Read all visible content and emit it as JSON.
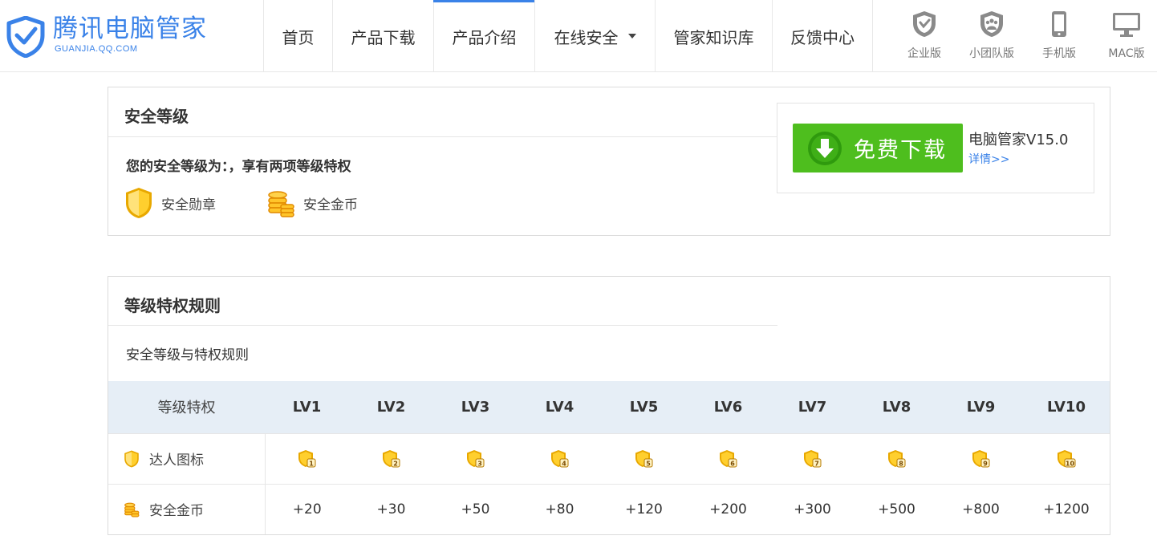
{
  "header": {
    "logo": {
      "title": "腾讯电脑管家",
      "subtitle": "GUANJIA.QQ.COM",
      "icon": "shield-check-icon"
    },
    "nav": [
      {
        "label": "首页",
        "active": false
      },
      {
        "label": "产品下载",
        "active": false
      },
      {
        "label": "产品介绍",
        "active": true
      },
      {
        "label": "在线安全",
        "active": false,
        "dropdown": true
      },
      {
        "label": "管家知识库",
        "active": false
      },
      {
        "label": "反馈中心",
        "active": false
      }
    ],
    "editions": [
      {
        "label": "企业版",
        "icon": "enterprise-shield-icon"
      },
      {
        "label": "小团队版",
        "icon": "team-shield-icon"
      },
      {
        "label": "手机版",
        "icon": "phone-icon"
      },
      {
        "label": "MAC版",
        "icon": "monitor-icon"
      }
    ]
  },
  "security_level": {
    "title": "安全等级",
    "level_text": "您的安全等级为：，享有两项等级特权",
    "perks": [
      {
        "label": "安全勋章",
        "icon": "medal-icon"
      },
      {
        "label": "安全金币",
        "icon": "coins-icon"
      }
    ]
  },
  "download": {
    "button_label": "免费下载",
    "version": "电脑管家V15.0",
    "detail_link": "详情>>"
  },
  "rules": {
    "title": "等级特权规则",
    "subtitle": "安全等级与特权规则",
    "header_first": "等级特权",
    "levels": [
      "LV1",
      "LV2",
      "LV3",
      "LV4",
      "LV5",
      "LV6",
      "LV7",
      "LV8",
      "LV9",
      "LV10"
    ],
    "badge_row_label": "达人图标",
    "badge_numbers": [
      "1",
      "2",
      "3",
      "4",
      "5",
      "6",
      "7",
      "8",
      "9",
      "10"
    ],
    "coin_row_label": "安全金币",
    "coins": [
      "+20",
      "+30",
      "+50",
      "+80",
      "+120",
      "+200",
      "+300",
      "+500",
      "+800",
      "+1200"
    ]
  },
  "colors": {
    "brand_blue": "#3a82e8",
    "download_green": "#4ebe1e",
    "table_header_bg": "#e6eef6",
    "medal_gold": "#f0b400"
  }
}
